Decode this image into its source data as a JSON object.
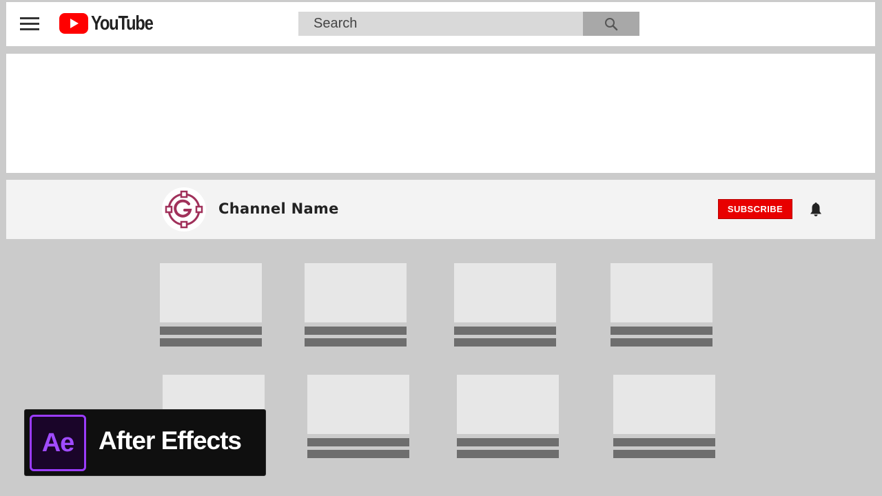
{
  "header": {
    "logo_text": "YouTube",
    "search_placeholder": "Search"
  },
  "channel": {
    "name": "Channel Name",
    "subscribe_label": "SUBSCRIBE"
  },
  "videos": {
    "row1_count": 4,
    "row2_count": 4
  },
  "overlay": {
    "app_short": "Ae",
    "app_name": "After Effects"
  },
  "colors": {
    "brand_red": "#e80000",
    "avatar_accent": "#a0305a",
    "ae_purple": "#9b3cff"
  }
}
